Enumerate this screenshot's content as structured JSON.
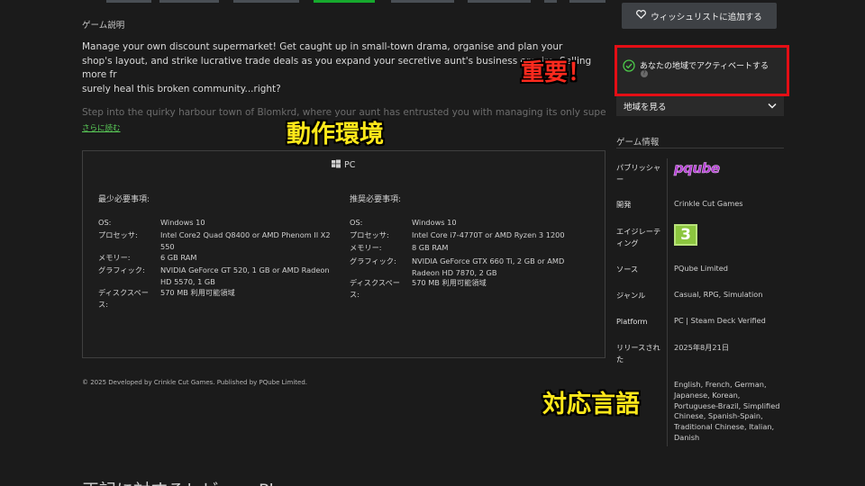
{
  "gallery": {
    "thumbnail_count": 8,
    "active_index": 3
  },
  "about": {
    "title": "ゲーム説明",
    "description": "Manage your own discount supermarket! Get caught up in small-town drama, organise and plan your shop's layout, and strike lucrative trade deals as you expand your secretive aunt's business empire. Selling more fr",
    "description_end": "surely heal this broken community...right?",
    "faded_text": "Step into the quirky harbour town of Blomkrd, where your aunt has entrusted you with managing its only supermarket",
    "read_more": "さらに読む"
  },
  "sysreq": {
    "platform": "PC",
    "minimum": {
      "title": "最少必要事項:",
      "rows": [
        {
          "label": "OS:",
          "value": "Windows 10"
        },
        {
          "label": "プロセッサ:",
          "value": "Intel Core2 Quad Q8400 or AMD Phenom II X2 550"
        },
        {
          "label": "メモリー:",
          "value": "6 GB RAM"
        },
        {
          "label": "グラフィック:",
          "value": "NVIDIA GeForce GT 520, 1 GB or AMD Radeon HD 5570, 1 GB"
        },
        {
          "label": "ディスクスペース:",
          "value": "570 MB 利用可能領域"
        }
      ]
    },
    "recommended": {
      "title": "推奨必要事項:",
      "rows": [
        {
          "label": "OS:",
          "value": "Windows 10"
        },
        {
          "label": "プロセッサ:",
          "value": "Intel Core i7-4770T or AMD Ryzen 3 1200"
        },
        {
          "label": "メモリー:",
          "value": "8 GB RAM"
        },
        {
          "label": "グラフィック:",
          "value": "NVIDIA GeForce GTX 660 Ti, 2 GB or AMD Radeon HD 7870, 2 GB"
        },
        {
          "label": "ディスクスペース:",
          "value": "570 MB 利用可能領域"
        }
      ]
    }
  },
  "copyright": "© 2025 Developed by Crinkle Cut Games. Published by PQube Limited.",
  "footer_heading_partial": "正記に対するレビュー  Please ...",
  "sidebar": {
    "wishlist_label": "ウィッシュリストに追加する",
    "activation_text": "あなたの地域でアクティベートする",
    "activation_help": "?",
    "region_label": "地域を見る",
    "info_title": "ゲーム情報",
    "publisher_label": "パブリッシャー",
    "publisher_logo_text": "pqube",
    "developer_label": "開発",
    "developer_value": "Crinkle Cut Games",
    "age_label": "エイジレーティング",
    "age_value": "3",
    "source_label": "ソース",
    "source_value": "PQube Limited",
    "genre_label": "ジャンル",
    "genre_value": "Casual, RPG, Simulation",
    "platform_label": "Platform",
    "platform_value": "PC | Steam Deck Verified",
    "release_label": "リリースされた",
    "release_value": "2025年8月21日",
    "languages_value": "English, French, German, Japanese, Korean, Portuguese-Brazil, Simplified Chinese, Spanish-Spain, Traditional Chinese, Italian, Danish"
  },
  "annotations": {
    "important": "重要！",
    "requirements": "動作環境",
    "languages": "対応言語"
  },
  "colors": {
    "accent_green": "#16a92d",
    "highlight_red": "#e40e15",
    "annotation_yellow": "#ffe81a"
  }
}
